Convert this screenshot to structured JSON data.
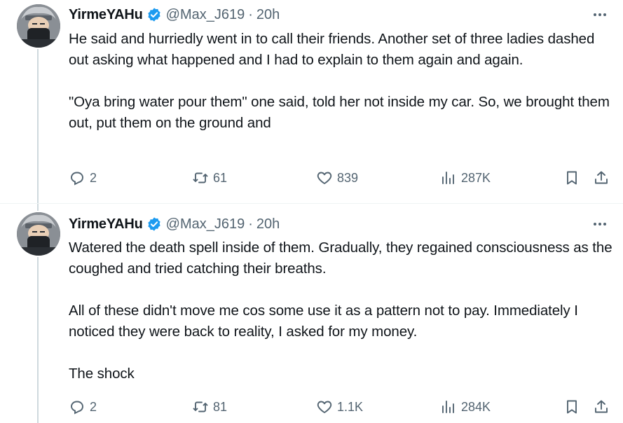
{
  "tweets": [
    {
      "author": {
        "name": "YirmeYAHu",
        "handle": "@Max_J619",
        "time": "20h"
      },
      "paragraphs": [
        "He said and hurriedly went in to call their friends. Another set of three ladies dashed out asking what happened and I had to explain to them again and again.",
        "\"Oya bring water pour them\" one said, told her not inside my car. So, we brought them out, put them on the ground and"
      ],
      "stats": {
        "replies": "2",
        "reposts": "61",
        "likes": "839",
        "views": "287K"
      }
    },
    {
      "author": {
        "name": "YirmeYAHu",
        "handle": "@Max_J619",
        "time": "20h"
      },
      "paragraphs": [
        "Watered the death spell inside of them. Gradually, they regained consciousness as the coughed and tried catching their breaths.",
        "All of these didn't move me cos some use it as a pattern not to pay. Immediately I noticed they were back to reality, I asked for my money.",
        "The shock"
      ],
      "stats": {
        "replies": "2",
        "reposts": "81",
        "likes": "1.1K",
        "views": "284K"
      }
    }
  ],
  "separator": "·",
  "colors": {
    "verified": "#1d9bf0",
    "secondary_text": "#536471",
    "primary_text": "#0f1419",
    "thread_line": "#cfd9de"
  },
  "icons": [
    "verified-badge-icon",
    "more-icon",
    "reply-icon",
    "repost-icon",
    "like-icon",
    "views-icon",
    "bookmark-icon",
    "share-icon"
  ]
}
